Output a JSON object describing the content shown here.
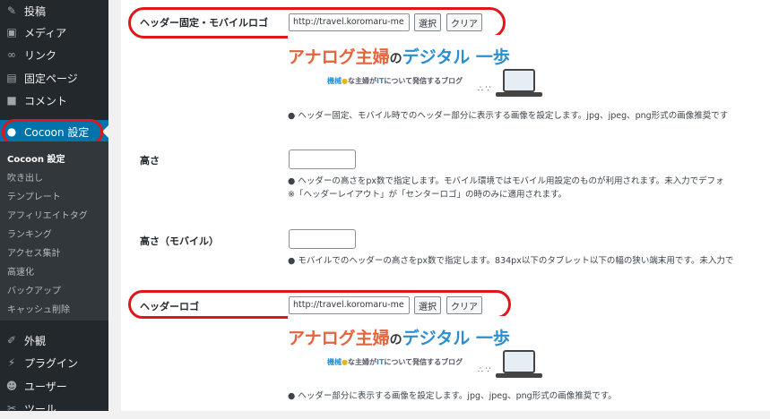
{
  "sidebar": {
    "items": [
      {
        "label": "投稿",
        "icon": "pin-icon"
      },
      {
        "label": "メディア",
        "icon": "media-icon"
      },
      {
        "label": "リンク",
        "icon": "link-icon"
      },
      {
        "label": "固定ページ",
        "icon": "page-icon"
      },
      {
        "label": "コメント",
        "icon": "comment-icon"
      },
      {
        "label": "Cocoon 設定",
        "icon": "cocoon-icon"
      }
    ],
    "submenu": [
      "Cocoon 設定",
      "吹き出し",
      "テンプレート",
      "アフィリエイトタグ",
      "ランキング",
      "アクセス集計",
      "高速化",
      "バックアップ",
      "キャッシュ削除"
    ],
    "bottom_items": [
      {
        "label": "外観",
        "icon": "brush-icon"
      },
      {
        "label": "プラグイン",
        "icon": "plugin-icon"
      },
      {
        "label": "ユーザー",
        "icon": "user-icon"
      },
      {
        "label": "ツール",
        "icon": "tool-icon"
      }
    ],
    "accent_color": "#0073aa",
    "highlight_color": "#e0161a"
  },
  "fields": {
    "mobile_logo": {
      "label": "ヘッダー固定・モバイルロゴ",
      "url": "http://travel.koromaru-me",
      "select": "選択",
      "clear": "クリア",
      "description": "ヘッダー固定、モバイル時でのヘッダー部分に表示する画像を設定します。jpg、jpeg、png形式の画像推奨です"
    },
    "height": {
      "label": "高さ",
      "value": "",
      "description": "ヘッダーの高さをpx数で指定します。モバイル環境ではモバイル用設定のものが利用されます。未入力でデフォ",
      "note": "※「ヘッダーレイアウト」が「センターロゴ」の時のみに適用されます。"
    },
    "height_mobile": {
      "label": "高さ（モバイル）",
      "value": "",
      "description": "モバイルでのヘッダーの高さをpx数で指定します。834px以下のタブレット以下の幅の狭い端末用です。未入力で"
    },
    "header_logo": {
      "label": "ヘッダーロゴ",
      "url": "http://travel.koromaru-me",
      "select": "選択",
      "clear": "クリア",
      "description": "ヘッダー部分に表示する画像を設定します。jpg、jpeg、png形式の画像推奨です。"
    }
  },
  "logo_image": {
    "part1": "アナログ主婦",
    "part2": "の",
    "part3": "デジタル",
    "part4": "一歩",
    "sub1": "機械",
    "sub2": "な主婦",
    "sub3": "が",
    "sub4": "IT",
    "sub5": "について発信するブログ"
  }
}
